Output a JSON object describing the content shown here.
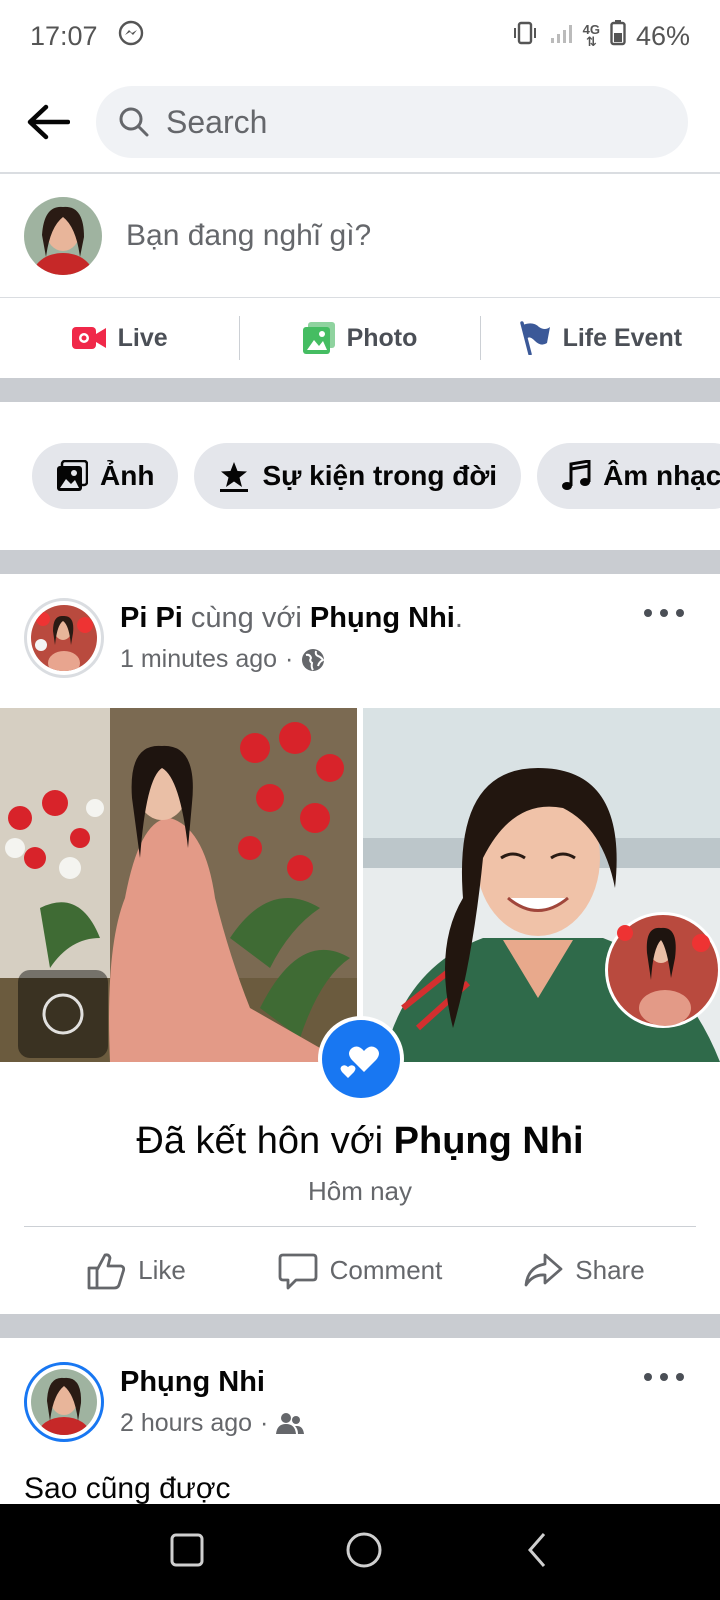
{
  "status_bar": {
    "time": "17:07",
    "battery": "46%",
    "network": "4G"
  },
  "search": {
    "placeholder": "Search"
  },
  "composer": {
    "prompt": "Bạn đang nghĩ gì?"
  },
  "composer_actions": [
    {
      "label": "Live",
      "icon": "live-video-icon",
      "color": "#f02849"
    },
    {
      "label": "Photo",
      "icon": "photo-icon",
      "color": "#45bd62"
    },
    {
      "label": "Life Event",
      "icon": "flag-icon",
      "color": "#3b5998"
    }
  ],
  "chips": [
    {
      "label": "Ảnh",
      "icon": "photo-icon"
    },
    {
      "label": "Sự kiện trong đời",
      "icon": "star-icon"
    },
    {
      "label": "Âm nhạc",
      "icon": "music-note-icon"
    }
  ],
  "post1": {
    "author": "Pi Pi",
    "with_text": "cùng với",
    "tagged": "Phụng Nhi",
    "period": ".",
    "time": "1 minutes ago",
    "dot": "·",
    "privacy_icon": "globe-icon",
    "event_prefix": "Đã kết hôn với",
    "event_name": "Phụng Nhi",
    "event_date": "Hôm nay",
    "actions": {
      "like": "Like",
      "comment": "Comment",
      "share": "Share"
    }
  },
  "post2": {
    "author": "Phụng Nhi",
    "time": "2 hours ago",
    "dot": "·",
    "privacy_icon": "friends-icon",
    "body": "Sao cũng được"
  },
  "colors": {
    "brand_blue": "#1877f2",
    "divider": "#c9ccd1"
  }
}
